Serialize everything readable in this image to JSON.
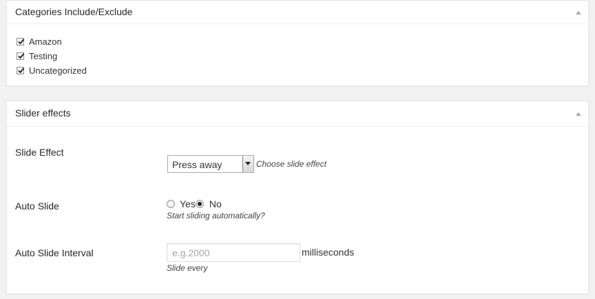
{
  "categories_box": {
    "title": "Categories Include/Exclude",
    "items": [
      {
        "label": "Amazon",
        "checked": true
      },
      {
        "label": "Testing",
        "checked": true
      },
      {
        "label": "Uncategorized",
        "checked": true
      }
    ]
  },
  "slider_box": {
    "title": "Slider effects",
    "slide_effect": {
      "label": "Slide Effect",
      "selected": "Press away",
      "description": "Choose slide effect"
    },
    "auto_slide": {
      "label": "Auto Slide",
      "options": [
        "Yes",
        "No"
      ],
      "selected": "No",
      "description": "Start sliding automatically?"
    },
    "auto_slide_interval": {
      "label": "Auto Slide Interval",
      "value": "",
      "placeholder": "e.g.2000",
      "unit": "milliseconds",
      "description": "Slide every"
    }
  },
  "icons": {
    "toggle": "triangle-up-icon",
    "checkbox": "checkmark-icon",
    "select": "chevron-down-icon"
  }
}
